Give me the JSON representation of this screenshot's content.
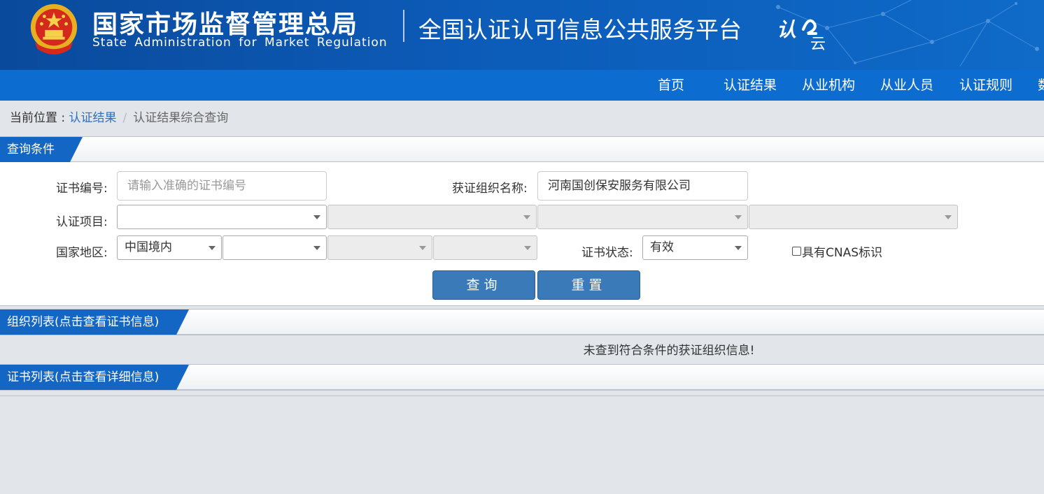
{
  "header": {
    "org_name_cn": "国家市场监督管理总局",
    "org_name_en": "State Administration  for  Market Regulation",
    "platform_title": "全国认证认可信息公共服务平台",
    "cloud_logo_text": "认云"
  },
  "nav": {
    "items": [
      {
        "label": "首页"
      },
      {
        "label": "认证结果"
      },
      {
        "label": "从业机构"
      },
      {
        "label": "从业人员"
      },
      {
        "label": "认证规则"
      },
      {
        "label": "数"
      }
    ]
  },
  "breadcrumb": {
    "prefix": "当前位置 : ",
    "link": "认证结果",
    "separator": "/",
    "current": "认证结果综合查询"
  },
  "query_panel": {
    "title": "查询条件",
    "cert_no_label": "证书编号:",
    "cert_no_placeholder": "请输入准确的证书编号",
    "org_name_label": "获证组织名称:",
    "org_name_value": "河南国创保安服务有限公司",
    "project_label": "认证项目:",
    "region_label": "国家地区:",
    "region_value": "中国境内",
    "status_label": "证书状态:",
    "status_value": "有效",
    "cnas_label": "具有CNAS标识",
    "search_button": "查询",
    "reset_button": "重置"
  },
  "org_list": {
    "title": "组织列表(点击查看证书信息)",
    "empty_message": "未查到符合条件的获证组织信息!"
  },
  "cert_list": {
    "title": "证书列表(点击查看详细信息)"
  },
  "colors": {
    "banner": "#0c5bb8",
    "nav": "#0d6cd0",
    "section_tab": "#1466c4",
    "button": "#3a7ab8",
    "link": "#2f6fbf"
  }
}
